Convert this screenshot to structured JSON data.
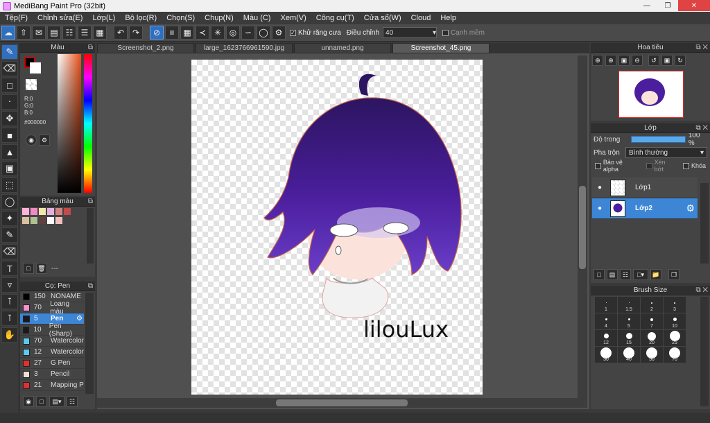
{
  "titlebar": {
    "title": "MediBang Paint Pro (32bit)"
  },
  "menu": [
    "Tệp(F)",
    "Chỉnh sửa(E)",
    "Lớp(L)",
    "Bộ lọc(R)",
    "Chọn(S)",
    "Chụp(N)",
    "Màu (C)",
    "Xem(V)",
    "Công cụ(T)",
    "Cửa sổ(W)",
    "Cloud",
    "Help"
  ],
  "toolbar": {
    "antialias_label": "Khử răng cưa",
    "adjust_label": "Điều chỉnh",
    "adjust_value": "40",
    "soft_edge_label": "Cạnh mềm"
  },
  "color_panel": {
    "title": "Màu",
    "r": "R:0",
    "g": "G:0",
    "b": "B:0",
    "hex": "#000000",
    "fg": "#000000",
    "bg": "#ffffff"
  },
  "palette_panel": {
    "title": "Bảng màu",
    "name": "---",
    "swatches": [
      "#ffb3d9",
      "#f08ac4",
      "#f3e6a8",
      "#e3b0e0",
      "#d28080",
      "#c54a4a",
      "#d9c0a0",
      "#b0c090",
      "#604040",
      "#ffffff",
      "#f0c0c0"
    ]
  },
  "brush_panel": {
    "title": "Cọ: Pen",
    "brushes": [
      {
        "size": "150",
        "name": "NONAME",
        "color": "#000000"
      },
      {
        "size": "70",
        "name": "Loang màu",
        "color": "#f78fd0"
      },
      {
        "size": "5",
        "name": "Pen",
        "color": "#1a1a1a"
      },
      {
        "size": "10",
        "name": "Pen (Sharp)",
        "color": "#1a1a1a"
      },
      {
        "size": "70",
        "name": "Watercolor",
        "color": "#5ec8ef"
      },
      {
        "size": "12",
        "name": "Watercolor",
        "color": "#5ec8ef"
      },
      {
        "size": "27",
        "name": "G Pen",
        "color": "#e03030"
      },
      {
        "size": "3",
        "name": "Pencil",
        "color": "#f0e0d0"
      },
      {
        "size": "21",
        "name": "Mapping P",
        "color": "#e03030"
      }
    ]
  },
  "tabs": [
    "Screenshot_2.png",
    "large_1623766961590.jpg",
    "unnamed.png",
    "Screenshot_45.png"
  ],
  "artwork": {
    "signature": "lilouLux"
  },
  "navigator": {
    "title": "Hoa tiêu"
  },
  "layers": {
    "title": "Lớp",
    "opacity_label": "Độ trong",
    "opacity_value": "100 %",
    "blend_label": "Pha trộn",
    "blend_value": "Bình thường",
    "protect_alpha": "Bảo vệ alpha",
    "clipping": "Xén bớt",
    "lock": "Khóa",
    "items": [
      {
        "name": "Lớp1"
      },
      {
        "name": "Lớp2"
      }
    ]
  },
  "brush_size": {
    "title": "Brush Size",
    "sizes": [
      "1",
      "1.5",
      "2",
      "3",
      "4",
      "5",
      "7",
      "10",
      "12",
      "15",
      "20",
      "25",
      "30",
      "40",
      "50",
      "70"
    ]
  }
}
